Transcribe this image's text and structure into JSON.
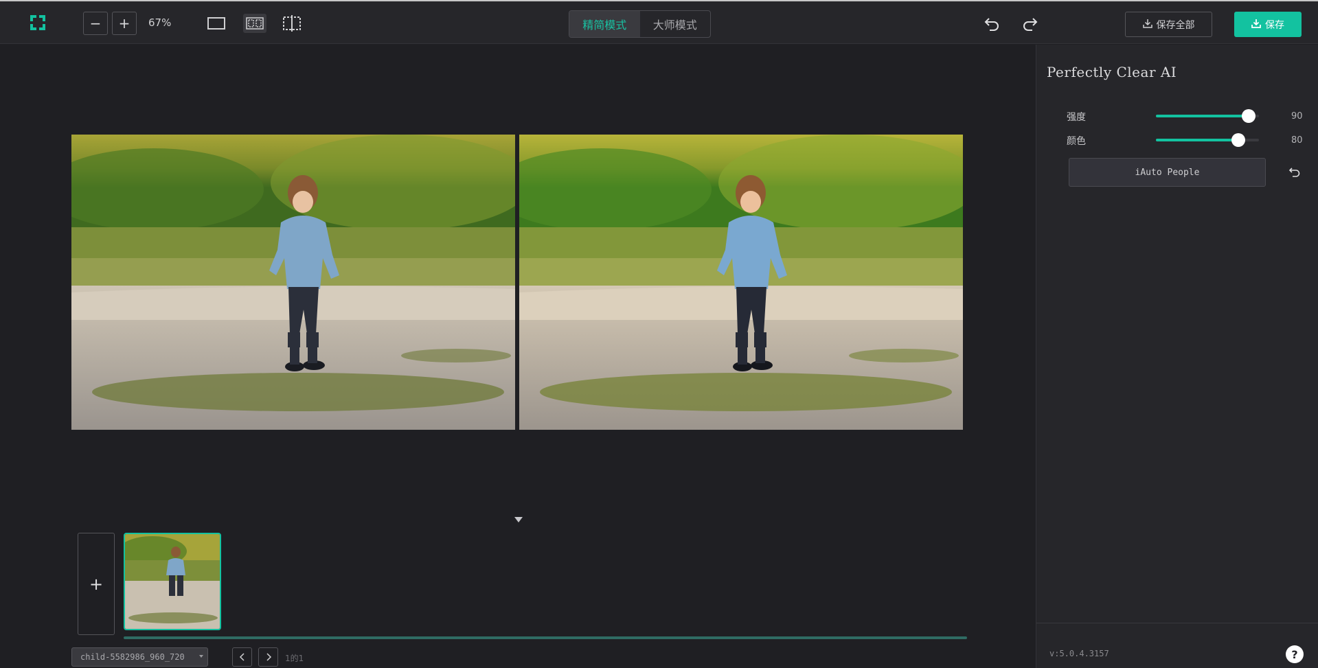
{
  "toolbar": {
    "zoom_out_symbol": "−",
    "zoom_in_symbol": "+",
    "zoom_level": "67%",
    "modes": [
      {
        "label": "精简模式",
        "active": true
      },
      {
        "label": "大师模式",
        "active": false
      }
    ],
    "save_all_label": "保存全部",
    "save_label": "保存",
    "icons": [
      "logo-icon",
      "single-view-icon",
      "split-view-icon",
      "crop-view-icon",
      "undo-icon",
      "redo-icon",
      "download-icon"
    ]
  },
  "colors": {
    "accent": "#13c2a0",
    "background": "#1f1f23",
    "panel": "#26262a"
  },
  "filmstrip": {
    "add_symbol": "+",
    "file_name": "child-5582986_960_720",
    "page_info": "1的1"
  },
  "panel": {
    "title": "Perfectly Clear AI",
    "sliders": [
      {
        "label": "强度",
        "value": 90,
        "max": 100
      },
      {
        "label": "颜色",
        "value": 80,
        "max": 100
      }
    ],
    "preset_button": "iAuto People",
    "version": "v:5.0.4.3157",
    "help_symbol": "?"
  }
}
